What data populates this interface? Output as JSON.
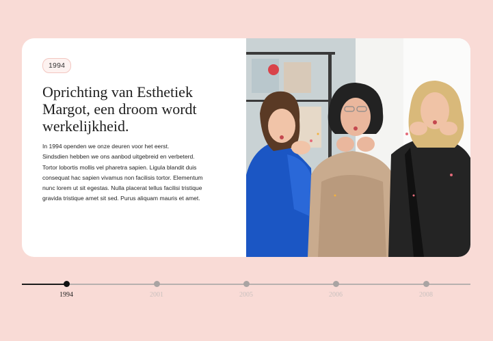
{
  "milestone": {
    "year_badge": "1994",
    "title": "Oprichting van Esthetiek Margot, een droom wordt werkelijkheid.",
    "paragraph_lines": [
      "In 1994 openden we onze deuren voor het eerst.",
      "Sindsdien hebben we ons aanbod uitgebreid en verbeterd.",
      "Tortor lobortis mollis vel pharetra sapien. Ligula blandit duis",
      "consequat hac sapien vivamus non facilisis tortor. Elementum",
      "nunc lorem ut sit egestas. Nulla placerat tellus facilisi tristique",
      "gravida tristique amet sit sed. Purus aliquam mauris et amet."
    ]
  },
  "timeline": {
    "active_index": 0,
    "years": [
      "1994",
      "2001",
      "2005",
      "2006",
      "2008"
    ]
  },
  "colors": {
    "page_background": "#f9dbd6",
    "card_background": "#ffffff",
    "badge_border": "#f2c6c0",
    "timeline_active": "#111111",
    "timeline_inactive": "#a9a4a3"
  }
}
